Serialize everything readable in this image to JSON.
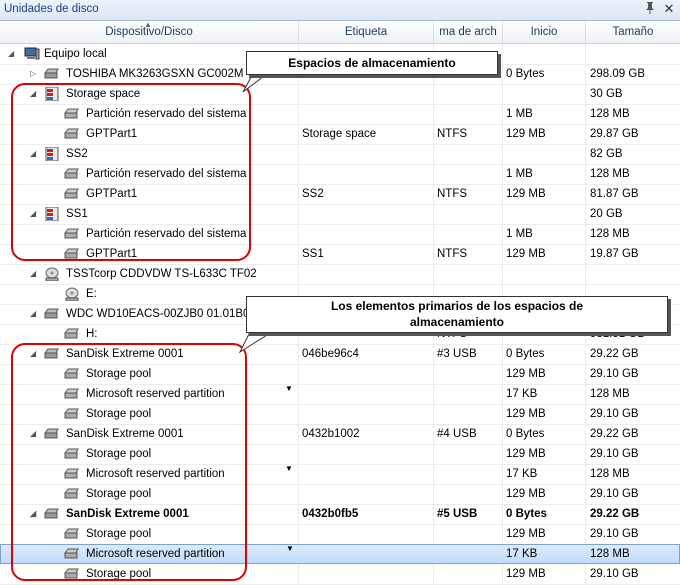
{
  "window": {
    "title": "Unidades de disco"
  },
  "columns": {
    "device": "Dispositivo/Disco",
    "label": "Etiqueta",
    "fs": "ma de arch",
    "start": "Inicio",
    "size": "Tamaño"
  },
  "root": {
    "label": "Equipo local"
  },
  "rows": [
    {
      "name": "TOSHIBA MK3263GSXN GC002M",
      "label": "",
      "fs": "",
      "start": "0 Bytes",
      "size": "298.09 GB"
    },
    {
      "name": "Storage space",
      "label": "",
      "fs": "",
      "start": "",
      "size": "30 GB"
    },
    {
      "name": "Partición reservado del sistema",
      "label": "",
      "fs": "",
      "start": "1 MB",
      "size": "128 MB"
    },
    {
      "name": "GPTPart1",
      "label": "Storage space",
      "fs": "NTFS",
      "start": "129 MB",
      "size": "29.87 GB"
    },
    {
      "name": "SS2",
      "label": "",
      "fs": "",
      "start": "",
      "size": "82 GB"
    },
    {
      "name": "Partición reservado del sistema",
      "label": "",
      "fs": "",
      "start": "1 MB",
      "size": "128 MB"
    },
    {
      "name": "GPTPart1",
      "label": "SS2",
      "fs": "NTFS",
      "start": "129 MB",
      "size": "81.87 GB"
    },
    {
      "name": "SS1",
      "label": "",
      "fs": "",
      "start": "",
      "size": "20 GB"
    },
    {
      "name": "Partición reservado del sistema",
      "label": "",
      "fs": "",
      "start": "1 MB",
      "size": "128 MB"
    },
    {
      "name": "GPTPart1",
      "label": "SS1",
      "fs": "NTFS",
      "start": "129 MB",
      "size": "19.87 GB"
    },
    {
      "name": "TSSTcorp CDDVDW TS-L633C TF02",
      "label": "",
      "fs": "",
      "start": "",
      "size": ""
    },
    {
      "name": "E:",
      "label": "",
      "fs": "",
      "start": "",
      "size": ""
    },
    {
      "name": "WDC WD10EACS-00ZJB0 01.01B01",
      "label": "",
      "fs": "",
      "start": "",
      "size": ""
    },
    {
      "name": "H:",
      "label": "",
      "fs": "NTFS",
      "start": "",
      "size": "931.51 GB"
    },
    {
      "name": "SanDisk Extreme 0001",
      "label": "046be96c4",
      "fs": "#3 USB",
      "start": "0 Bytes",
      "size": "29.22 GB"
    },
    {
      "name": "Storage pool",
      "label": "",
      "fs": "",
      "start": "129 MB",
      "size": "29.10 GB"
    },
    {
      "name": "Microsoft reserved partition",
      "label": "",
      "fs": "",
      "start": "17 KB",
      "size": "128 MB"
    },
    {
      "name": "Storage pool",
      "label": "",
      "fs": "",
      "start": "129 MB",
      "size": "29.10 GB"
    },
    {
      "name": "SanDisk Extreme 0001",
      "label": "0432b1002",
      "fs": "#4 USB",
      "start": "0 Bytes",
      "size": "29.22 GB"
    },
    {
      "name": "Storage pool",
      "label": "",
      "fs": "",
      "start": "129 MB",
      "size": "29.10 GB"
    },
    {
      "name": "Microsoft reserved partition",
      "label": "",
      "fs": "",
      "start": "17 KB",
      "size": "128 MB"
    },
    {
      "name": "Storage pool",
      "label": "",
      "fs": "",
      "start": "129 MB",
      "size": "29.10 GB"
    },
    {
      "name": "SanDisk Extreme 0001",
      "label": "0432b0fb5",
      "fs": "#5 USB",
      "start": "0 Bytes",
      "size": "29.22 GB"
    },
    {
      "name": "Storage pool",
      "label": "",
      "fs": "",
      "start": "129 MB",
      "size": "29.10 GB"
    },
    {
      "name": "Microsoft reserved partition",
      "label": "",
      "fs": "",
      "start": "17 KB",
      "size": "128 MB"
    },
    {
      "name": "Storage pool",
      "label": "",
      "fs": "",
      "start": "129 MB",
      "size": "29.10 GB"
    }
  ],
  "callouts": {
    "spaces": "Espacios de almacenamiento",
    "primary_line1": "Los elementos primarios de los espacios de",
    "primary_line2": "almacenamiento"
  },
  "partial_text": {
    "start_fragment": "mp",
    "start_fragment_b": "l1"
  },
  "colors": {
    "accent": "#15428b",
    "selection": "#c1dbfc",
    "callout_border": "#e00000"
  }
}
